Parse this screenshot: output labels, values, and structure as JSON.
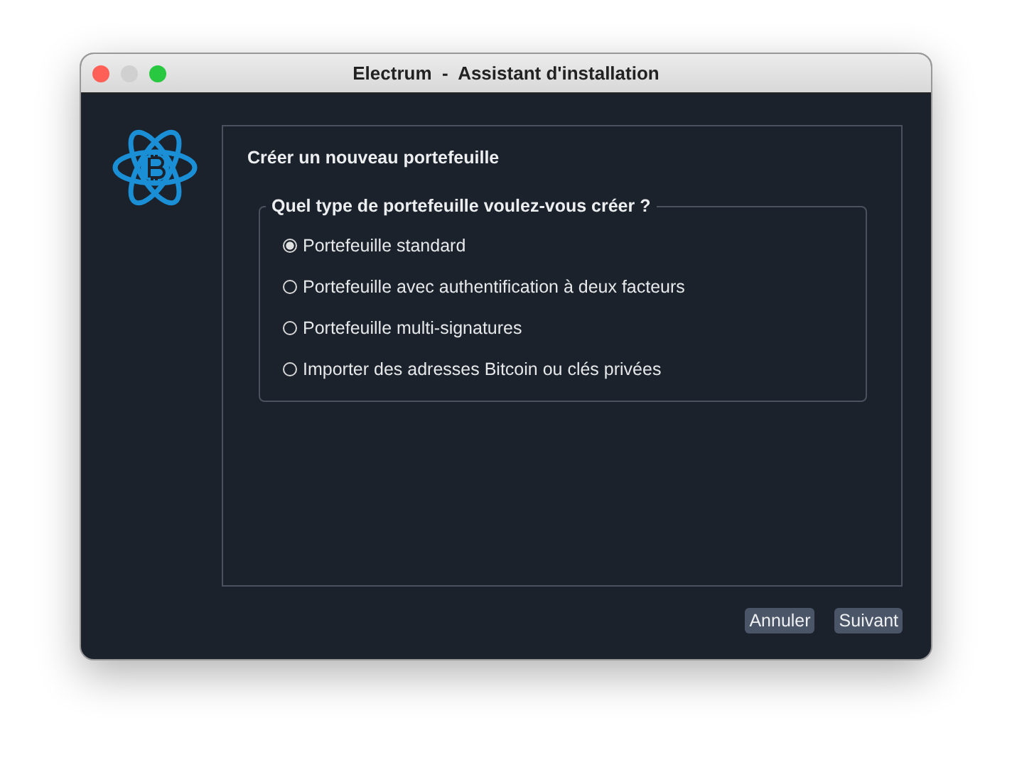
{
  "window": {
    "title": "Electrum  -  Assistant d'installation"
  },
  "heading": "Créer un nouveau portefeuille",
  "group": {
    "title": "Quel type de portefeuille voulez-vous créer ?",
    "options": [
      {
        "label": "Portefeuille standard",
        "selected": true
      },
      {
        "label": "Portefeuille avec authentification à deux facteurs",
        "selected": false
      },
      {
        "label": "Portefeuille multi-signatures",
        "selected": false
      },
      {
        "label": "Importer des adresses Bitcoin ou clés privées",
        "selected": false
      }
    ]
  },
  "buttons": [
    "Annuler",
    "Suivant"
  ]
}
